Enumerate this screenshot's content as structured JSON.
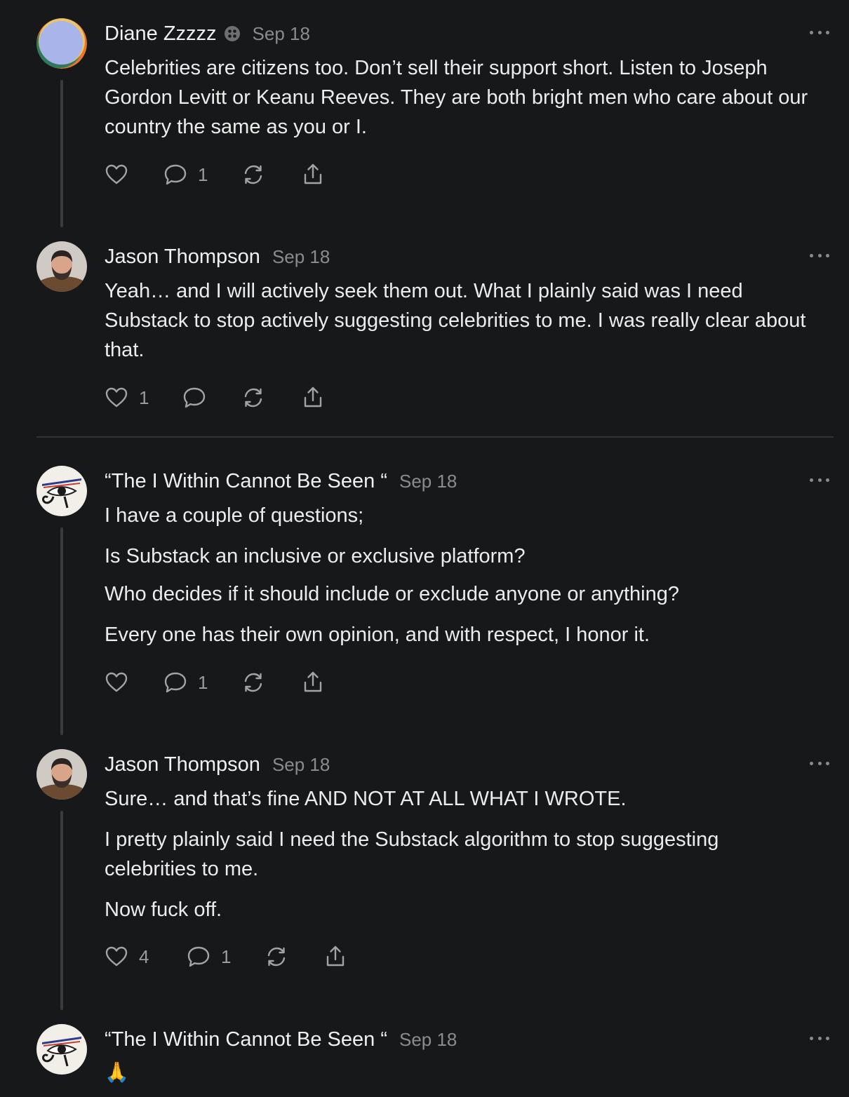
{
  "comments": [
    {
      "author": "Diane Zzzzz",
      "date": "Sep 18",
      "paragraphs": [
        "Celebrities are citizens too. Don’t sell their support short. Listen to Joseph Gordon Levitt or Keanu Reeves. They are both bright men who care about our country the same as you or I."
      ],
      "likes": "",
      "replies": "1"
    },
    {
      "author": "Jason Thompson",
      "date": "Sep 18",
      "paragraphs": [
        "Yeah… and I will actively seek them out. What I plainly said was I need Substack to stop actively suggesting celebrities to me. I was really clear about that."
      ],
      "likes": "1",
      "replies": ""
    },
    {
      "author": "“The I Within Cannot Be Seen “",
      "date": "Sep 18",
      "paragraphs": [
        "I have a couple of questions;",
        "Is Substack an inclusive or exclusive platform?",
        "Who decides if it should include or exclude anyone or anything?",
        "Every one has their own opinion, and with respect, I honor it."
      ],
      "likes": "",
      "replies": "1"
    },
    {
      "author": "Jason Thompson",
      "date": "Sep 18",
      "paragraphs": [
        "Sure… and that’s fine AND NOT AT ALL WHAT I WROTE.",
        "I pretty plainly said I need the Substack algorithm to stop suggesting celebrities to me.",
        "Now fuck off."
      ],
      "likes": "4",
      "replies": "1"
    },
    {
      "author": "“The I Within Cannot Be Seen “",
      "date": "Sep 18",
      "paragraphs": [
        "🙏"
      ]
    }
  ],
  "icons": {
    "like": "heart-icon",
    "reply": "comment-bubble-icon",
    "restack": "restack-icon",
    "share": "share-icon",
    "more": "more-dots-icon",
    "badge": "subscriber-badge-icon"
  },
  "colors": {
    "background": "#17181a",
    "text": "#ececec",
    "muted": "#8a8b8f",
    "thread_line": "#3a3b3e"
  }
}
